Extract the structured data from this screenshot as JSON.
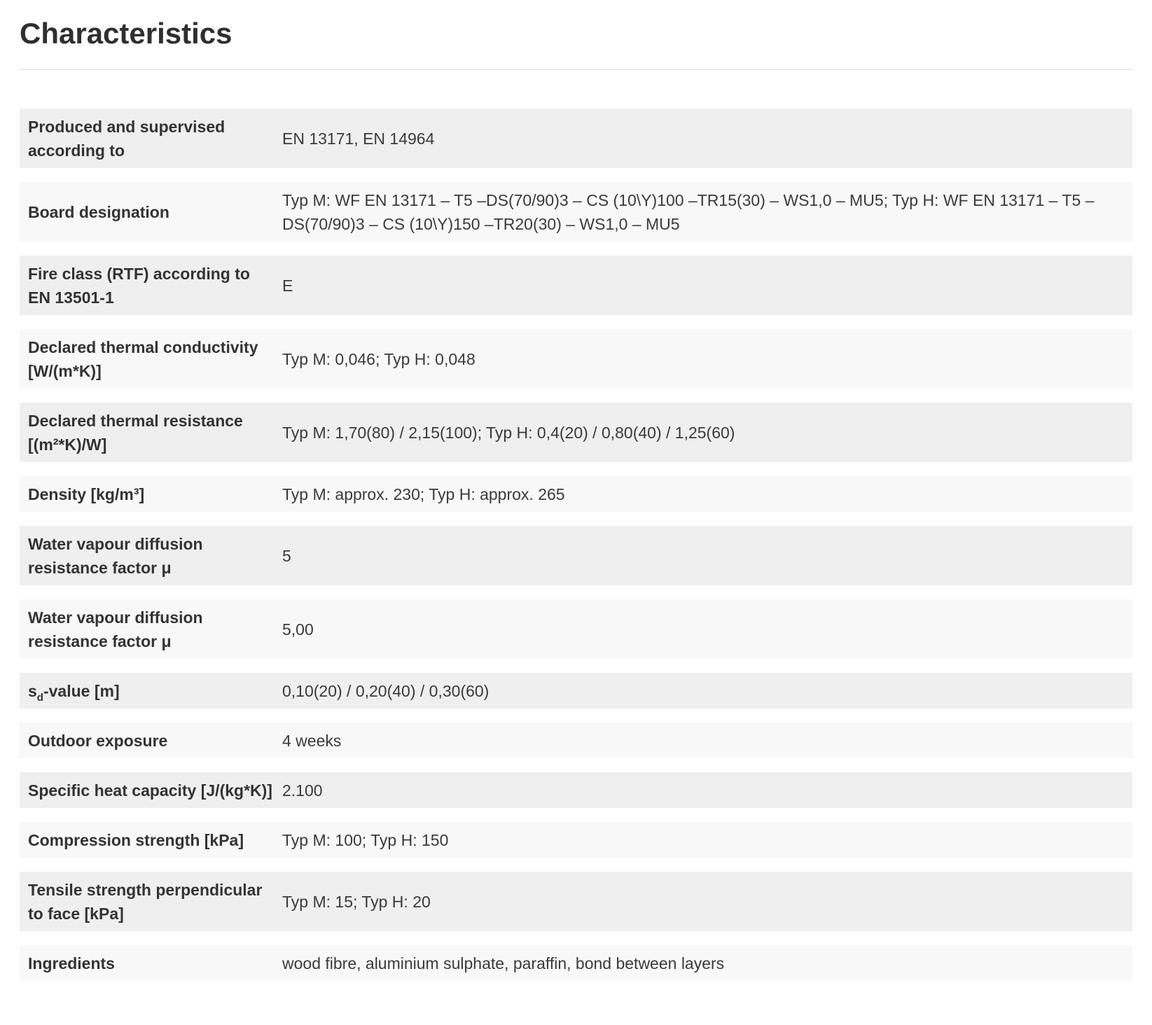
{
  "page": {
    "title": "Characteristics"
  },
  "rows": [
    {
      "label": "Produced and supervised according to",
      "value": "EN 13171, EN 14964"
    },
    {
      "label": "Board designation",
      "value": "Typ M: WF EN 13171 – T5 –DS(70/90)3 – CS (10\\Y)100 –TR15(30) – WS1,0 – MU5; Typ H: WF EN 13171 – T5 – DS(70/90)3 – CS (10\\Y)150 –TR20(30) – WS1,0 – MU5"
    },
    {
      "label": "Fire class (RTF) according to EN 13501-1",
      "value": "E"
    },
    {
      "label": "Declared thermal conductivity [W/(m*K)]",
      "value": "Typ M: 0,046; Typ H: 0,048"
    },
    {
      "label": "Declared thermal resistance [(m²*K)/W]",
      "value": "Typ M: 1,70(80) / 2,15(100); Typ H: 0,4(20) / 0,80(40) / 1,25(60)"
    },
    {
      "label": "Density [kg/m³]",
      "value": "Typ M: approx. 230; Typ H: approx. 265"
    },
    {
      "label": "Water vapour diffusion resistance factor μ",
      "value": "5"
    },
    {
      "label": "Water vapour diffusion resistance factor μ",
      "value": "5,00"
    },
    {
      "label_main": "s",
      "label_sub": "d",
      "label_rest": "-value [m]",
      "value": "0,10(20) / 0,20(40) / 0,30(60)"
    },
    {
      "label": "Outdoor exposure",
      "value": "4 weeks"
    },
    {
      "label": "Specific heat capacity [J/(kg*K)]",
      "value": "2.100"
    },
    {
      "label": "Compression strength [kPa]",
      "value": "Typ M: 100; Typ H: 150"
    },
    {
      "label": "Tensile strength perpendicular to face [kPa]",
      "value": "Typ M: 15; Typ H: 20"
    },
    {
      "label": "Ingredients",
      "value": "wood fibre, aluminium sulphate, paraffin, bond between layers"
    }
  ]
}
